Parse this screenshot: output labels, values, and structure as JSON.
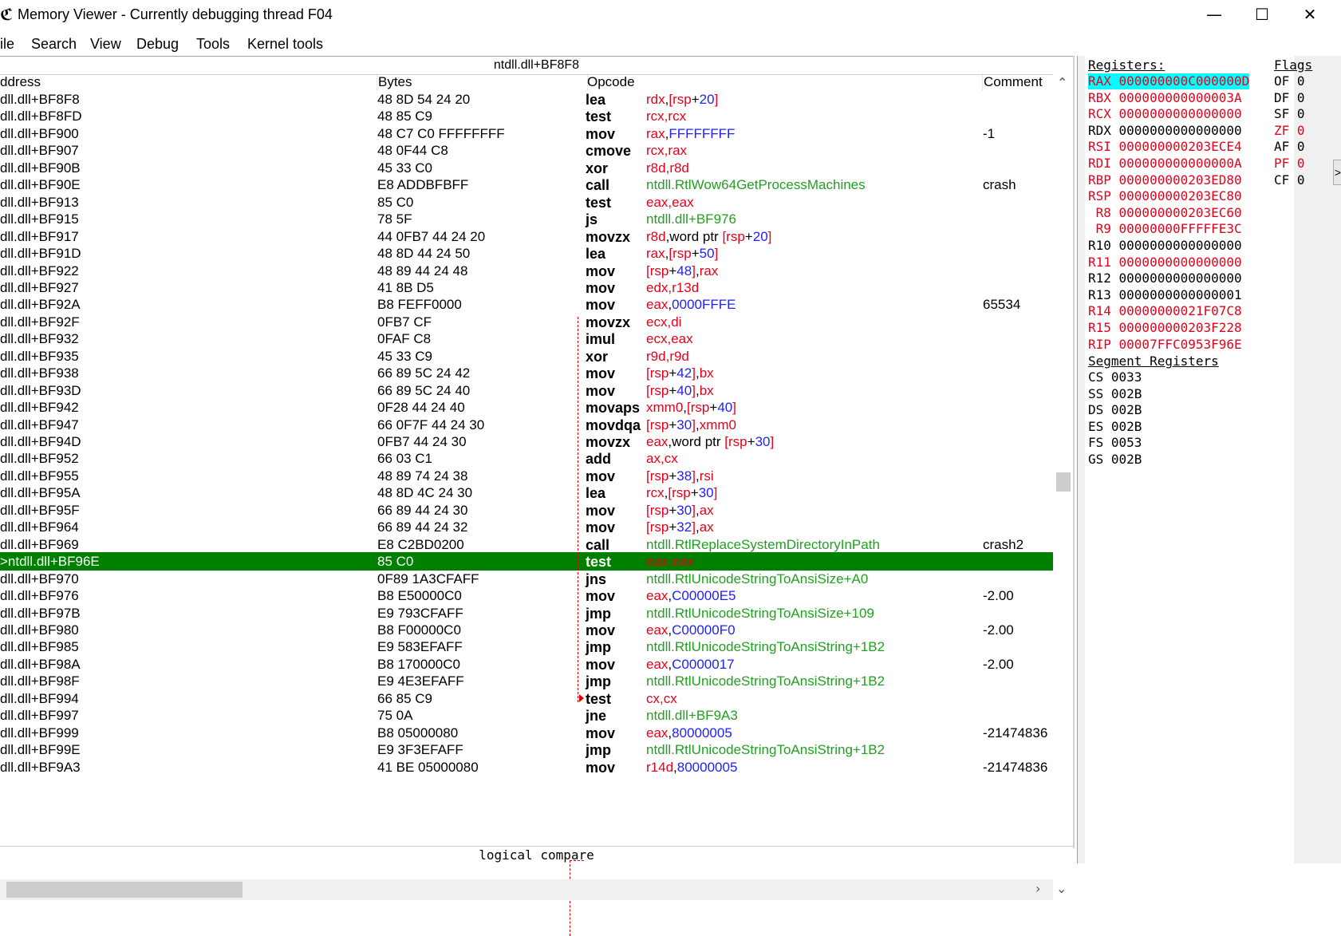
{
  "window": {
    "title": "Memory Viewer - Currently debugging thread F04",
    "minimize": "—",
    "maximize": "☐",
    "close": "✕"
  },
  "menu": [
    "ile",
    "Search",
    "View",
    "Debug",
    "Tools",
    "Kernel tools"
  ],
  "disassembler": {
    "header_address": "ntdll.dll+BF8F8",
    "columns": {
      "address": "ddress",
      "bytes": "Bytes",
      "opcode": "Opcode",
      "comment": "Comment"
    },
    "rows": [
      {
        "addr": "dll.dll+BF8F8",
        "bytes": "48 8D 54 24 20",
        "mnem": "lea",
        "ops": [
          [
            "rdx",
            "r"
          ],
          [
            ",",
            ""
          ],
          [
            "[",
            "r"
          ],
          [
            "rsp",
            "r"
          ],
          [
            "+",
            "k"
          ],
          [
            "20",
            "b"
          ],
          [
            "]",
            "r"
          ]
        ],
        "cmt": ""
      },
      {
        "addr": "dll.dll+BF8FD",
        "bytes": "48 85 C9",
        "mnem": "test",
        "ops": [
          [
            "rcx",
            "r"
          ],
          [
            ",",
            "r"
          ],
          [
            "rcx",
            "r"
          ]
        ],
        "cmt": ""
      },
      {
        "addr": "dll.dll+BF900",
        "bytes": "48 C7 C0 FFFFFFFF",
        "mnem": "mov",
        "ops": [
          [
            "rax",
            "r"
          ],
          [
            ",",
            "k"
          ],
          [
            "FFFFFFFF",
            "b"
          ]
        ],
        "cmt": "-1"
      },
      {
        "addr": "dll.dll+BF907",
        "bytes": "48 0F44 C8",
        "mnem": "cmove",
        "ops": [
          [
            "rcx",
            "r"
          ],
          [
            ",",
            "r"
          ],
          [
            "rax",
            "r"
          ]
        ],
        "cmt": ""
      },
      {
        "addr": "dll.dll+BF90B",
        "bytes": "45 33 C0",
        "mnem": "xor",
        "ops": [
          [
            "r8d",
            "r"
          ],
          [
            ",",
            "r"
          ],
          [
            "r8d",
            "r"
          ]
        ],
        "cmt": ""
      },
      {
        "addr": "dll.dll+BF90E",
        "bytes": "E8 ADDBFBFF",
        "mnem": "call",
        "ops": [
          [
            "ntdll.RtlWow64GetProcessMachines",
            "g"
          ]
        ],
        "cmt": "crash"
      },
      {
        "addr": "dll.dll+BF913",
        "bytes": "85 C0",
        "mnem": "test",
        "ops": [
          [
            "eax",
            "r"
          ],
          [
            ",",
            "r"
          ],
          [
            "eax",
            "r"
          ]
        ],
        "cmt": ""
      },
      {
        "addr": "dll.dll+BF915",
        "bytes": "78 5F",
        "mnem": "js",
        "ops": [
          [
            "ntdll.dll+BF976",
            "g"
          ]
        ],
        "cmt": ""
      },
      {
        "addr": "dll.dll+BF917",
        "bytes": "44 0FB7 44 24 20",
        "mnem": "movzx",
        "ops": [
          [
            "r8d",
            "r"
          ],
          [
            ",word ptr ",
            "k"
          ],
          [
            "[",
            "r"
          ],
          [
            "rsp",
            "r"
          ],
          [
            "+",
            "k"
          ],
          [
            "20",
            "b"
          ],
          [
            "]",
            "r"
          ]
        ],
        "cmt": ""
      },
      {
        "addr": "dll.dll+BF91D",
        "bytes": "48 8D 44 24 50",
        "mnem": "lea",
        "ops": [
          [
            "rax",
            "r"
          ],
          [
            ",",
            "k"
          ],
          [
            "[",
            "r"
          ],
          [
            "rsp",
            "r"
          ],
          [
            "+",
            "k"
          ],
          [
            "50",
            "b"
          ],
          [
            "]",
            "r"
          ]
        ],
        "cmt": ""
      },
      {
        "addr": "dll.dll+BF922",
        "bytes": "48 89 44 24 48",
        "mnem": "mov",
        "ops": [
          [
            "[",
            "r"
          ],
          [
            "rsp",
            "r"
          ],
          [
            "+",
            "k"
          ],
          [
            "48",
            "b"
          ],
          [
            "]",
            "r"
          ],
          [
            ",",
            "k"
          ],
          [
            "rax",
            "r"
          ]
        ],
        "cmt": ""
      },
      {
        "addr": "dll.dll+BF927",
        "bytes": "41 8B D5",
        "mnem": "mov",
        "ops": [
          [
            "edx",
            "r"
          ],
          [
            ",",
            "r"
          ],
          [
            "r13d",
            "r"
          ]
        ],
        "cmt": ""
      },
      {
        "addr": "dll.dll+BF92A",
        "bytes": "B8 FEFF0000",
        "mnem": "mov",
        "ops": [
          [
            "eax",
            "r"
          ],
          [
            ",",
            "k"
          ],
          [
            "0000FFFE",
            "b"
          ]
        ],
        "cmt": "65534"
      },
      {
        "addr": "dll.dll+BF92F",
        "bytes": "0FB7 CF",
        "mnem": "movzx",
        "ops": [
          [
            "ecx",
            "r"
          ],
          [
            ",",
            "r"
          ],
          [
            "di",
            "r"
          ]
        ],
        "cmt": ""
      },
      {
        "addr": "dll.dll+BF932",
        "bytes": "0FAF C8",
        "mnem": "imul",
        "ops": [
          [
            "ecx",
            "r"
          ],
          [
            ",",
            "r"
          ],
          [
            "eax",
            "r"
          ]
        ],
        "cmt": ""
      },
      {
        "addr": "dll.dll+BF935",
        "bytes": "45 33 C9",
        "mnem": "xor",
        "ops": [
          [
            "r9d",
            "r"
          ],
          [
            ",",
            "r"
          ],
          [
            "r9d",
            "r"
          ]
        ],
        "cmt": ""
      },
      {
        "addr": "dll.dll+BF938",
        "bytes": "66 89 5C 24 42",
        "mnem": "mov",
        "ops": [
          [
            "[",
            "r"
          ],
          [
            "rsp",
            "r"
          ],
          [
            "+",
            "k"
          ],
          [
            "42",
            "b"
          ],
          [
            "]",
            "r"
          ],
          [
            ",",
            "k"
          ],
          [
            "bx",
            "r"
          ]
        ],
        "cmt": ""
      },
      {
        "addr": "dll.dll+BF93D",
        "bytes": "66 89 5C 24 40",
        "mnem": "mov",
        "ops": [
          [
            "[",
            "r"
          ],
          [
            "rsp",
            "r"
          ],
          [
            "+",
            "k"
          ],
          [
            "40",
            "b"
          ],
          [
            "]",
            "r"
          ],
          [
            ",",
            "k"
          ],
          [
            "bx",
            "r"
          ]
        ],
        "cmt": ""
      },
      {
        "addr": "dll.dll+BF942",
        "bytes": "0F28 44 24 40",
        "mnem": "movaps",
        "ops": [
          [
            " xmm0",
            "r"
          ],
          [
            ",",
            "k"
          ],
          [
            "[",
            "r"
          ],
          [
            "rsp",
            "r"
          ],
          [
            "+",
            "k"
          ],
          [
            "40",
            "b"
          ],
          [
            "]",
            "r"
          ]
        ],
        "cmt": ""
      },
      {
        "addr": "dll.dll+BF947",
        "bytes": "66 0F7F 44 24 30",
        "mnem": "movdqa",
        "ops": [
          [
            " [",
            "r"
          ],
          [
            "rsp",
            "r"
          ],
          [
            "+",
            "k"
          ],
          [
            "30",
            "b"
          ],
          [
            "]",
            "r"
          ],
          [
            ",",
            "k"
          ],
          [
            "xmm0",
            "r"
          ]
        ],
        "cmt": ""
      },
      {
        "addr": "dll.dll+BF94D",
        "bytes": "0FB7 44 24 30",
        "mnem": "movzx",
        "ops": [
          [
            "eax",
            "r"
          ],
          [
            ",word ptr ",
            "k"
          ],
          [
            "[",
            "r"
          ],
          [
            "rsp",
            "r"
          ],
          [
            "+",
            "k"
          ],
          [
            "30",
            "b"
          ],
          [
            "]",
            "r"
          ]
        ],
        "cmt": ""
      },
      {
        "addr": "dll.dll+BF952",
        "bytes": "66 03 C1",
        "mnem": "add",
        "ops": [
          [
            "ax",
            "r"
          ],
          [
            ",",
            "r"
          ],
          [
            "cx",
            "r"
          ]
        ],
        "cmt": ""
      },
      {
        "addr": "dll.dll+BF955",
        "bytes": "48 89 74 24 38",
        "mnem": "mov",
        "ops": [
          [
            "[",
            "r"
          ],
          [
            "rsp",
            "r"
          ],
          [
            "+",
            "k"
          ],
          [
            "38",
            "b"
          ],
          [
            "]",
            "r"
          ],
          [
            ",",
            "k"
          ],
          [
            "rsi",
            "r"
          ]
        ],
        "cmt": ""
      },
      {
        "addr": "dll.dll+BF95A",
        "bytes": "48 8D 4C 24 30",
        "mnem": "lea",
        "ops": [
          [
            "rcx",
            "r"
          ],
          [
            ",",
            "k"
          ],
          [
            "[",
            "r"
          ],
          [
            "rsp",
            "r"
          ],
          [
            "+",
            "k"
          ],
          [
            "30",
            "b"
          ],
          [
            "]",
            "r"
          ]
        ],
        "cmt": ""
      },
      {
        "addr": "dll.dll+BF95F",
        "bytes": "66 89 44 24 30",
        "mnem": "mov",
        "ops": [
          [
            "[",
            "r"
          ],
          [
            "rsp",
            "r"
          ],
          [
            "+",
            "k"
          ],
          [
            "30",
            "b"
          ],
          [
            "]",
            "r"
          ],
          [
            ",",
            "k"
          ],
          [
            "ax",
            "r"
          ]
        ],
        "cmt": ""
      },
      {
        "addr": "dll.dll+BF964",
        "bytes": "66 89 44 24 32",
        "mnem": "mov",
        "ops": [
          [
            "[",
            "r"
          ],
          [
            "rsp",
            "r"
          ],
          [
            "+",
            "k"
          ],
          [
            "32",
            "b"
          ],
          [
            "]",
            "r"
          ],
          [
            ",",
            "k"
          ],
          [
            "ax",
            "r"
          ]
        ],
        "cmt": ""
      },
      {
        "addr": "dll.dll+BF969",
        "bytes": "E8 C2BD0200",
        "mnem": "call",
        "ops": [
          [
            "ntdll.RtlReplaceSystemDirectoryInPath",
            "g"
          ]
        ],
        "cmt": "crash2"
      },
      {
        "addr": ">ntdll.dll+BF96E",
        "bytes": "85 C0",
        "mnem": "test",
        "ops": [
          [
            "eax",
            "r"
          ],
          [
            ",",
            "r"
          ],
          [
            "eax",
            "r"
          ]
        ],
        "cmt": "",
        "selected": true
      },
      {
        "addr": "dll.dll+BF970",
        "bytes": "0F89 1A3CFAFF",
        "mnem": "jns",
        "ops": [
          [
            "ntdll.RtlUnicodeStringToAnsiSize+A0",
            "g"
          ]
        ],
        "cmt": ""
      },
      {
        "addr": "dll.dll+BF976",
        "bytes": "B8 E50000C0",
        "mnem": "mov",
        "ops": [
          [
            "eax",
            "r"
          ],
          [
            ",",
            "k"
          ],
          [
            "C00000E5",
            "b"
          ]
        ],
        "cmt": "-2.00"
      },
      {
        "addr": "dll.dll+BF97B",
        "bytes": "E9 793CFAFF",
        "mnem": "jmp",
        "ops": [
          [
            "ntdll.RtlUnicodeStringToAnsiSize+109",
            "g"
          ]
        ],
        "cmt": ""
      },
      {
        "addr": "dll.dll+BF980",
        "bytes": "B8 F00000C0",
        "mnem": "mov",
        "ops": [
          [
            "eax",
            "r"
          ],
          [
            ",",
            "k"
          ],
          [
            "C00000F0",
            "b"
          ]
        ],
        "cmt": "-2.00"
      },
      {
        "addr": "dll.dll+BF985",
        "bytes": "E9 583EFAFF",
        "mnem": "jmp",
        "ops": [
          [
            "ntdll.RtlUnicodeStringToAnsiString+1B2",
            "g"
          ]
        ],
        "cmt": ""
      },
      {
        "addr": "dll.dll+BF98A",
        "bytes": "B8 170000C0",
        "mnem": "mov",
        "ops": [
          [
            "eax",
            "r"
          ],
          [
            ",",
            "k"
          ],
          [
            "C0000017",
            "b"
          ]
        ],
        "cmt": "-2.00"
      },
      {
        "addr": "dll.dll+BF98F",
        "bytes": "E9 4E3EFAFF",
        "mnem": "jmp",
        "ops": [
          [
            "ntdll.RtlUnicodeStringToAnsiString+1B2",
            "g"
          ]
        ],
        "cmt": ""
      },
      {
        "addr": "dll.dll+BF994",
        "bytes": "66 85 C9",
        "mnem": "test",
        "ops": [
          [
            "cx",
            "r"
          ],
          [
            ",",
            "r"
          ],
          [
            "cx",
            "r"
          ]
        ],
        "cmt": ""
      },
      {
        "addr": "dll.dll+BF997",
        "bytes": "75 0A",
        "mnem": "jne",
        "ops": [
          [
            "ntdll.dll+BF9A3",
            "g"
          ]
        ],
        "cmt": ""
      },
      {
        "addr": "dll.dll+BF999",
        "bytes": "B8 05000080",
        "mnem": "mov",
        "ops": [
          [
            "eax",
            "r"
          ],
          [
            ",",
            "k"
          ],
          [
            "80000005",
            "b"
          ]
        ],
        "cmt": "-21474836"
      },
      {
        "addr": "dll.dll+BF99E",
        "bytes": "E9 3F3EFAFF",
        "mnem": "jmp",
        "ops": [
          [
            "ntdll.RtlUnicodeStringToAnsiString+1B2",
            "g"
          ]
        ],
        "cmt": ""
      },
      {
        "addr": "dll.dll+BF9A3",
        "bytes": "41 BE 05000080",
        "mnem": "mov",
        "ops": [
          [
            "r14d",
            "r"
          ],
          [
            ",",
            "k"
          ],
          [
            "80000005",
            "b"
          ]
        ],
        "cmt": "-21474836"
      }
    ]
  },
  "status_bar": "logical compare",
  "registers": {
    "header": "Registers:",
    "general": [
      {
        "name": "RAX",
        "value": "000000000C000000D",
        "state": "highlight"
      },
      {
        "name": "RBX",
        "value": "000000000000003A",
        "state": "changed"
      },
      {
        "name": "RCX",
        "value": "0000000000000000",
        "state": "changed"
      },
      {
        "name": "RDX",
        "value": "0000000000000000",
        "state": "normal"
      },
      {
        "name": "RSI",
        "value": "000000000203ECE4",
        "state": "changed"
      },
      {
        "name": "RDI",
        "value": "000000000000000A",
        "state": "changed"
      },
      {
        "name": "RBP",
        "value": "000000000203ED80",
        "state": "changed"
      },
      {
        "name": "RSP",
        "value": "000000000203EC80",
        "state": "changed"
      },
      {
        "name": " R8",
        "value": "000000000203EC60",
        "state": "changed"
      },
      {
        "name": " R9",
        "value": "00000000FFFFFE3C",
        "state": "changed"
      },
      {
        "name": "R10",
        "value": "0000000000000000",
        "state": "normal"
      },
      {
        "name": "R11",
        "value": "0000000000000000",
        "state": "changed"
      },
      {
        "name": "R12",
        "value": "0000000000000000",
        "state": "normal"
      },
      {
        "name": "R13",
        "value": "0000000000000001",
        "state": "normal"
      },
      {
        "name": "R14",
        "value": "00000000021F07C8",
        "state": "changed"
      },
      {
        "name": "R15",
        "value": "000000000203F228",
        "state": "changed"
      },
      {
        "name": "RIP",
        "value": "00007FFC0953F96E",
        "state": "changed"
      }
    ],
    "segment_header": "Segment Registers",
    "segments": [
      {
        "name": "CS",
        "value": "0033"
      },
      {
        "name": "SS",
        "value": "002B"
      },
      {
        "name": "DS",
        "value": "002B"
      },
      {
        "name": "ES",
        "value": "002B"
      },
      {
        "name": "FS",
        "value": "0053"
      },
      {
        "name": "GS",
        "value": "002B"
      }
    ]
  },
  "flags": {
    "header": "Flags",
    "items": [
      {
        "name": "OF",
        "value": "0",
        "state": "normal"
      },
      {
        "name": "DF",
        "value": "0",
        "state": "normal"
      },
      {
        "name": "SF",
        "value": "0",
        "state": "normal"
      },
      {
        "name": "ZF",
        "value": "0",
        "state": "changed"
      },
      {
        "name": "AF",
        "value": "0",
        "state": "normal"
      },
      {
        "name": "PF",
        "value": "0",
        "state": "changed"
      },
      {
        "name": "CF",
        "value": "0",
        "state": "normal"
      }
    ]
  },
  "scroll": {
    "up": "⌃",
    "down": "⌄",
    "right": "›"
  },
  "expander": ">"
}
